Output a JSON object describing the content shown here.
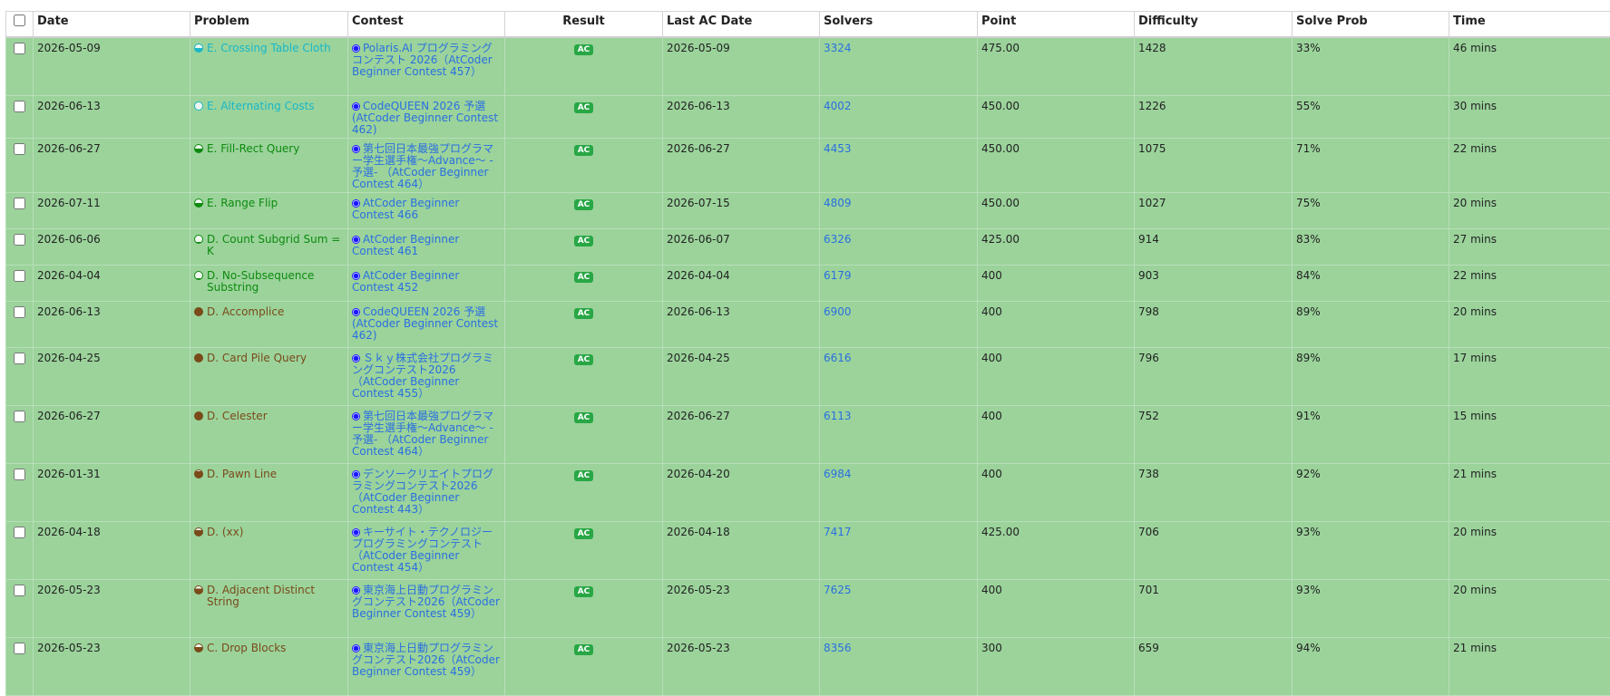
{
  "headers": [
    "Date",
    "Problem",
    "Contest",
    "Result",
    "Last AC Date",
    "Solvers",
    "Point",
    "Difficulty",
    "Solve Prob",
    "Time"
  ],
  "colors": {
    "row_bg": "#9bd39b",
    "link": "#2a6fe0",
    "ac": "#28a745",
    "cyan": "#19b7c8",
    "green": "#0e8a0e",
    "brown": "#7a4a1a"
  },
  "rows": [
    {
      "date": "2026-05-09",
      "problem": "E. Crossing Table Cloth",
      "prob_color": "cyan",
      "icon_fill": 0.5,
      "contest": "Polaris.AI プログラミングコンテスト 2026（AtCoder Beginner Contest 457）",
      "result": "AC",
      "last_ac": "2026-05-09",
      "solvers": "3324",
      "point": "475.00",
      "difficulty": "1428",
      "solve_prob": "33%",
      "time": "46 mins"
    },
    {
      "date": "2026-06-13",
      "problem": "E. Alternating Costs",
      "prob_color": "cyan",
      "icon_fill": 0.0,
      "contest": "CodeQUEEN 2026 予選 (AtCoder Beginner Contest 462)",
      "result": "AC",
      "last_ac": "2026-06-13",
      "solvers": "4002",
      "point": "450.00",
      "difficulty": "1226",
      "solve_prob": "55%",
      "time": "30 mins"
    },
    {
      "date": "2026-06-27",
      "problem": "E. Fill-Rect Query",
      "prob_color": "green",
      "icon_fill": 0.5,
      "contest": "第七回日本最強プログラマー学生選手権～Advance～ -予選- （AtCoder Beginner Contest 464）",
      "result": "AC",
      "last_ac": "2026-06-27",
      "solvers": "4453",
      "point": "450.00",
      "difficulty": "1075",
      "solve_prob": "71%",
      "time": "22 mins"
    },
    {
      "date": "2026-07-11",
      "problem": "E. Range Flip",
      "prob_color": "green",
      "icon_fill": 0.5,
      "contest": "AtCoder Beginner Contest 466",
      "result": "AC",
      "last_ac": "2026-07-15",
      "solvers": "4809",
      "point": "450.00",
      "difficulty": "1027",
      "solve_prob": "75%",
      "time": "20 mins"
    },
    {
      "date": "2026-06-06",
      "problem": "D. Count Subgrid Sum = K",
      "prob_color": "green",
      "icon_fill": 0.1,
      "contest": "AtCoder Beginner Contest 461",
      "result": "AC",
      "last_ac": "2026-06-07",
      "solvers": "6326",
      "point": "425.00",
      "difficulty": "914",
      "solve_prob": "83%",
      "time": "27 mins"
    },
    {
      "date": "2026-04-04",
      "problem": "D. No-Subsequence Substring",
      "prob_color": "green",
      "icon_fill": 0.1,
      "contest": "AtCoder Beginner Contest 452",
      "result": "AC",
      "last_ac": "2026-04-04",
      "solvers": "6179",
      "point": "400",
      "difficulty": "903",
      "solve_prob": "84%",
      "time": "22 mins"
    },
    {
      "date": "2026-06-13",
      "problem": "D. Accomplice",
      "prob_color": "brown",
      "icon_fill": 1.0,
      "contest": "CodeQUEEN 2026 予選 (AtCoder Beginner Contest 462)",
      "result": "AC",
      "last_ac": "2026-06-13",
      "solvers": "6900",
      "point": "400",
      "difficulty": "798",
      "solve_prob": "89%",
      "time": "20 mins"
    },
    {
      "date": "2026-04-25",
      "problem": "D. Card Pile Query",
      "prob_color": "brown",
      "icon_fill": 1.0,
      "contest": "Ｓｋｙ株式会社プログラミングコンテスト2026（AtCoder Beginner Contest 455）",
      "result": "AC",
      "last_ac": "2026-04-25",
      "solvers": "6616",
      "point": "400",
      "difficulty": "796",
      "solve_prob": "89%",
      "time": "17 mins"
    },
    {
      "date": "2026-06-27",
      "problem": "D. Celester",
      "prob_color": "brown",
      "icon_fill": 1.0,
      "contest": "第七回日本最強プログラマー学生選手権～Advance～ -予選- （AtCoder Beginner Contest 464）",
      "result": "AC",
      "last_ac": "2026-06-27",
      "solvers": "6113",
      "point": "400",
      "difficulty": "752",
      "solve_prob": "91%",
      "time": "15 mins"
    },
    {
      "date": "2026-01-31",
      "problem": "D. Pawn Line",
      "prob_color": "brown",
      "icon_fill": 0.85,
      "contest": "デンソークリエイトプログラミングコンテスト2026（AtCoder Beginner Contest 443）",
      "result": "AC",
      "last_ac": "2026-04-20",
      "solvers": "6984",
      "point": "400",
      "difficulty": "738",
      "solve_prob": "92%",
      "time": "21 mins"
    },
    {
      "date": "2026-04-18",
      "problem": "D. (xx)",
      "prob_color": "brown",
      "icon_fill": 0.75,
      "contest": "キーサイト・テクノロジープログラミングコンテスト（AtCoder Beginner Contest 454）",
      "result": "AC",
      "last_ac": "2026-04-18",
      "solvers": "7417",
      "point": "425.00",
      "difficulty": "706",
      "solve_prob": "93%",
      "time": "20 mins"
    },
    {
      "date": "2026-05-23",
      "problem": "D. Adjacent Distinct String",
      "prob_color": "brown",
      "icon_fill": 0.7,
      "contest": "東京海上日動プログラミングコンテスト2026（AtCoder Beginner Contest 459）",
      "result": "AC",
      "last_ac": "2026-05-23",
      "solvers": "7625",
      "point": "400",
      "difficulty": "701",
      "solve_prob": "93%",
      "time": "20 mins"
    },
    {
      "date": "2026-05-23",
      "problem": "C. Drop Blocks",
      "prob_color": "brown",
      "icon_fill": 0.6,
      "contest": "東京海上日動プログラミングコンテスト2026（AtCoder Beginner Contest 459）",
      "result": "AC",
      "last_ac": "2026-05-23",
      "solvers": "8356",
      "point": "300",
      "difficulty": "659",
      "solve_prob": "94%",
      "time": "21 mins"
    }
  ]
}
